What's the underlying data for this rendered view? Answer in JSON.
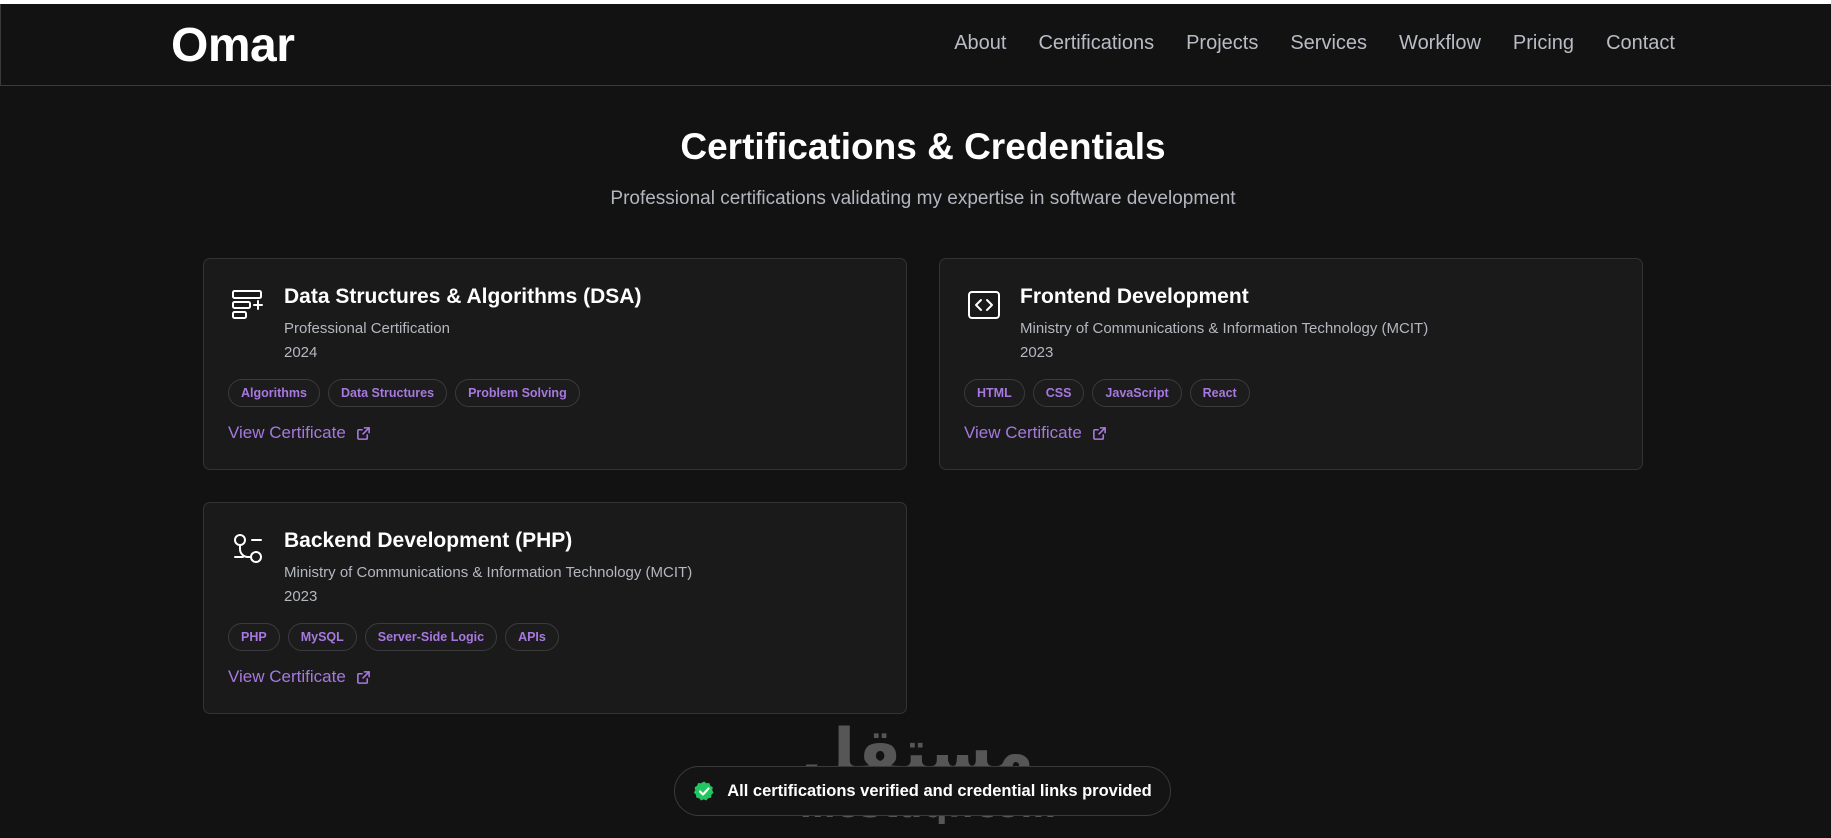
{
  "header": {
    "logo": "Omar",
    "nav": [
      "About",
      "Certifications",
      "Projects",
      "Services",
      "Workflow",
      "Pricing",
      "Contact"
    ]
  },
  "section": {
    "title": "Certifications & Credentials",
    "subtitle": "Professional certifications validating my expertise in software development"
  },
  "cards": [
    {
      "icon": "list-add-icon",
      "title": "Data Structures & Algorithms (DSA)",
      "issuer": "Professional Certification",
      "year": "2024",
      "tags": [
        "Algorithms",
        "Data Structures",
        "Problem Solving"
      ],
      "link_label": "View Certificate"
    },
    {
      "icon": "code-icon",
      "title": "Frontend Development",
      "issuer": "Ministry of Communications & Information Technology (MCIT)",
      "year": "2023",
      "tags": [
        "HTML",
        "CSS",
        "JavaScript",
        "React"
      ],
      "link_label": "View Certificate"
    },
    {
      "icon": "git-branch-icon",
      "title": "Backend Development (PHP)",
      "issuer": "Ministry of Communications & Information Technology (MCIT)",
      "year": "2023",
      "tags": [
        "PHP",
        "MySQL",
        "Server-Side Logic",
        "APIs"
      ],
      "link_label": "View Certificate"
    }
  ],
  "verified": {
    "text": "All certifications verified and credential links provided",
    "icon": "check-badge-icon"
  },
  "watermark": {
    "arabic": "مستقل",
    "latin": "mostaql.com"
  },
  "colors": {
    "background": "#121212",
    "card": "#1a1a1a",
    "accent": "#a778e0",
    "success": "#22c55e"
  }
}
